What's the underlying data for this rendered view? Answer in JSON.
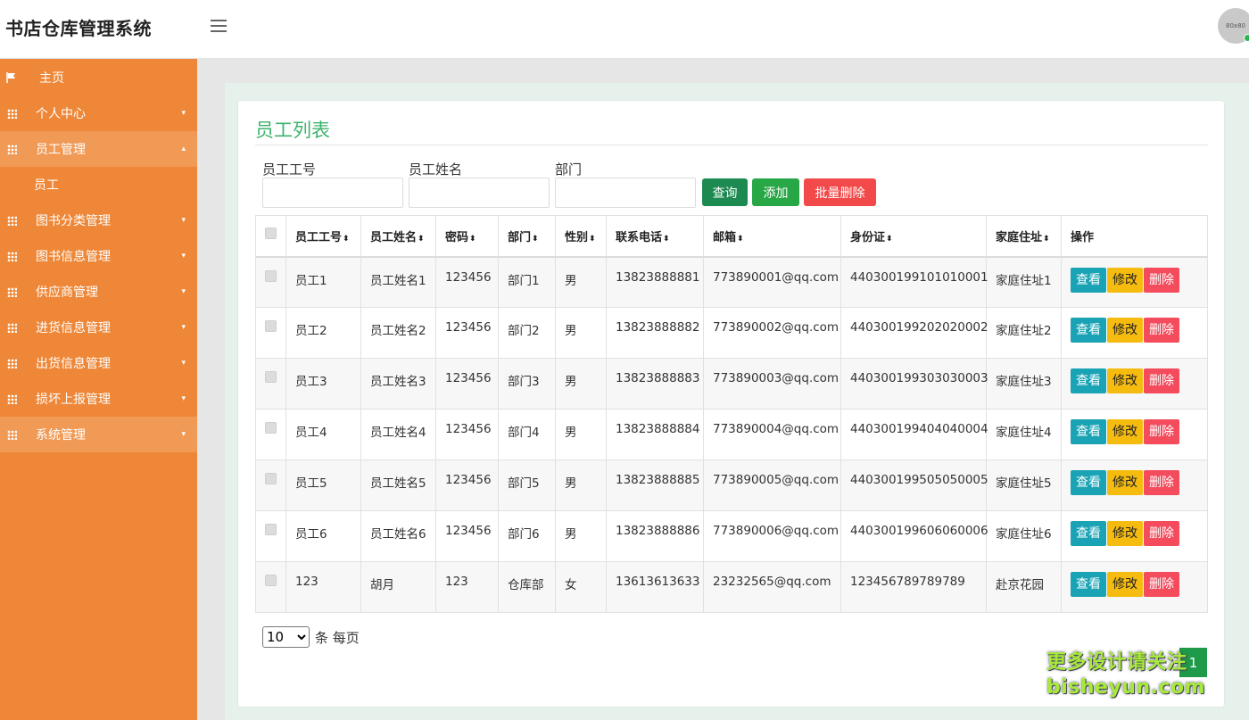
{
  "app": {
    "title": "书店仓库管理系统",
    "avatar_text": "80x80"
  },
  "sidebar": {
    "items": [
      {
        "label": "主页",
        "icon": "flag-icon"
      },
      {
        "label": "个人中心",
        "icon": "grid-icon"
      },
      {
        "label": "员工管理",
        "icon": "grid-icon"
      },
      {
        "label": "员工"
      },
      {
        "label": "图书分类管理",
        "icon": "grid-icon"
      },
      {
        "label": "图书信息管理",
        "icon": "grid-icon"
      },
      {
        "label": "供应商管理",
        "icon": "grid-icon"
      },
      {
        "label": "进货信息管理",
        "icon": "grid-icon"
      },
      {
        "label": "出货信息管理",
        "icon": "grid-icon"
      },
      {
        "label": "损坏上报管理",
        "icon": "grid-icon"
      },
      {
        "label": "系统管理",
        "icon": "grid-icon"
      }
    ]
  },
  "main": {
    "title": "员工列表",
    "filters": {
      "emp_no": "员工工号",
      "emp_name": "员工姓名",
      "dept": "部门"
    },
    "buttons": {
      "query": "查询",
      "add": "添加",
      "batch_delete": "批量删除"
    },
    "table": {
      "columns": [
        "员工工号",
        "员工姓名",
        "密码",
        "部门",
        "性别",
        "联系电话",
        "邮箱",
        "身份证",
        "家庭住址",
        "操作"
      ],
      "rows": [
        [
          "员工1",
          "员工姓名1",
          "123456",
          "部门1",
          "男",
          "13823888881",
          "773890001@qq.com",
          "440300199101010001",
          "家庭住址1"
        ],
        [
          "员工2",
          "员工姓名2",
          "123456",
          "部门2",
          "男",
          "13823888882",
          "773890002@qq.com",
          "440300199202020002",
          "家庭住址2"
        ],
        [
          "员工3",
          "员工姓名3",
          "123456",
          "部门3",
          "男",
          "13823888883",
          "773890003@qq.com",
          "440300199303030003",
          "家庭住址3"
        ],
        [
          "员工4",
          "员工姓名4",
          "123456",
          "部门4",
          "男",
          "13823888884",
          "773890004@qq.com",
          "440300199404040004",
          "家庭住址4"
        ],
        [
          "员工5",
          "员工姓名5",
          "123456",
          "部门5",
          "男",
          "13823888885",
          "773890005@qq.com",
          "440300199505050005",
          "家庭住址5"
        ],
        [
          "员工6",
          "员工姓名6",
          "123456",
          "部门6",
          "男",
          "13823888886",
          "773890006@qq.com",
          "440300199606060006",
          "家庭住址6"
        ],
        [
          "123",
          "胡月",
          "123",
          "仓库部",
          "女",
          "13613613633",
          "23232565@qq.com",
          "123456789789789",
          "赴京花园"
        ]
      ],
      "actions": {
        "view": "查看",
        "edit": "修改",
        "delete": "删除"
      }
    },
    "pagination": {
      "page_size": "10",
      "per_page_label": "条 每页",
      "current_page": "1"
    }
  },
  "watermark": {
    "line1": "更多设计请关注",
    "line2": "bisheyun.com"
  },
  "colors": {
    "sidebar": "#ee8737",
    "title_green": "#3db36b",
    "page_green": "#1e9a49"
  }
}
